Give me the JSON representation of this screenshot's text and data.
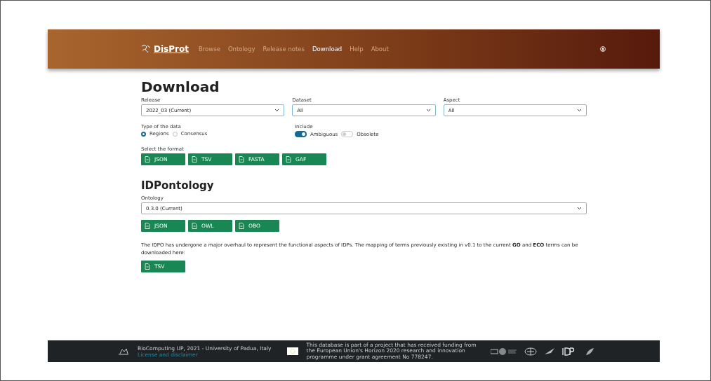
{
  "navbar": {
    "brand": "DisProt",
    "links": [
      {
        "label": "Browse",
        "selected": false
      },
      {
        "label": "Ontology",
        "selected": false
      },
      {
        "label": "Release notes",
        "selected": false
      },
      {
        "label": "Download",
        "selected": true
      },
      {
        "label": "Help",
        "selected": false
      },
      {
        "label": "About",
        "selected": false
      }
    ]
  },
  "download": {
    "title": "Download",
    "selects": [
      {
        "label": "Release",
        "value": "2022_03 (Current)"
      },
      {
        "label": "Dataset",
        "value": "All"
      },
      {
        "label": "Aspect",
        "value": "All"
      }
    ],
    "type_of_data": {
      "label": "Type of the data",
      "options": [
        {
          "label": "Regions",
          "selected": true
        },
        {
          "label": "Consensus",
          "selected": false
        }
      ]
    },
    "include": {
      "label": "Include",
      "toggles": [
        {
          "label": "Ambiguous",
          "on": true
        },
        {
          "label": "Obsolete",
          "on": false
        }
      ]
    },
    "format": {
      "label": "Select the format",
      "buttons": [
        "JSON",
        "TSV",
        "FASTA",
        "GAF"
      ]
    }
  },
  "ontology": {
    "title": "IDPontology",
    "select": {
      "label": "Ontology",
      "value": "0.3.0 (Current)"
    },
    "buttons": [
      "JSON",
      "OWL",
      "OBO"
    ],
    "note": "The IDPO has undergone a major overhaul to represent the functional aspects of IDPs. The mapping of terms previously existing in v0.1 to the current **GO** and **ECO** terms can be downloaded here:",
    "note_buttons": [
      "TSV"
    ]
  },
  "footer": {
    "credit": "BioComputing UP, 2021 - University of Padua, Italy",
    "license_link": "License and disclaimer",
    "funding": "This database is part of a project that has received funding from the European Union's Horizon 2020 research and innovation programme under grant agreement No 778247."
  }
}
